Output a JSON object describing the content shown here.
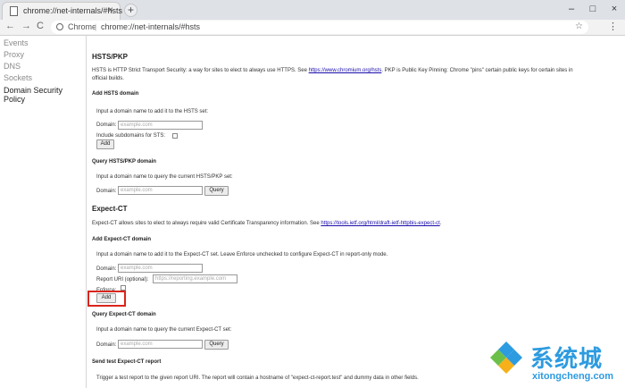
{
  "tab": {
    "title": "chrome://net-internals/#hsts",
    "close": "×"
  },
  "newtab": "+",
  "window": {
    "minimize": "–",
    "maximize": "□",
    "close": "×"
  },
  "toolbar": {
    "back": "←",
    "forward": "→",
    "reload": "C",
    "origin": "Chrome",
    "separator": "|",
    "url": "chrome://net-internals/#hsts",
    "star": "☆",
    "menu": "⋮"
  },
  "sidebar": {
    "items": [
      "Events",
      "Proxy",
      "DNS",
      "Sockets",
      "Domain Security Policy"
    ]
  },
  "main": {
    "hsts_title": "HSTS/PKP",
    "hsts_desc_1a": "HSTS is HTTP Strict Transport Security: a way for sites to elect to always use HTTPS. See ",
    "hsts_link": "https://www.chromium.org/hsts",
    "hsts_desc_1b": ". PKP is Public Key Pinning: Chrome \"pins\" certain public keys for certain sites in",
    "hsts_desc_2": "official builds.",
    "add_hsts_title": "Add HSTS domain",
    "add_hsts_text": "Input a domain name to add it to the HSTS set:",
    "domain_label": "Domain:",
    "domain_placeholder": "example.com",
    "include_subdomains_label": "Include subdomains for STS:",
    "add_label": "Add",
    "query_hsts_title": "Query HSTS/PKP domain",
    "query_hsts_text": "Input a domain name to query the current HSTS/PKP set:",
    "query_label": "Query",
    "expect_ct_title": "Expect-CT",
    "expect_ct_desc": "Expect-CT allows sites to elect to always require valid Certificate Transparency information. See ",
    "expect_ct_link": "https://tools.ietf.org/html/draft-ietf-httpbis-expect-ct",
    "expect_ct_desc_end": ".",
    "add_ct_title": "Add Expect-CT domain",
    "add_ct_text": "Input a domain name to add it to the Expect-CT set. Leave Enforce unchecked to configure Expect-CT in report-only mode.",
    "report_uri_label": "Report URI (optional):",
    "report_uri_placeholder": "https://reporting.example.com",
    "enforce_label": "Enforce:",
    "query_ct_title": "Query Expect-CT domain",
    "query_ct_text": "Input a domain name to query the current Expect-CT set:",
    "send_test_title": "Send test Expect-CT report",
    "send_test_text": "Trigger a test report to the given report URI. The report will contain a hostname of \"expect-ct-report.test\" and dummy data in other fields."
  },
  "watermark": {
    "cn": "系统城",
    "en": "xitongcheng.com"
  },
  "colors": {
    "highlight": "#d9251d",
    "link": "#1a0dab",
    "watermark": "#2d9be0"
  }
}
